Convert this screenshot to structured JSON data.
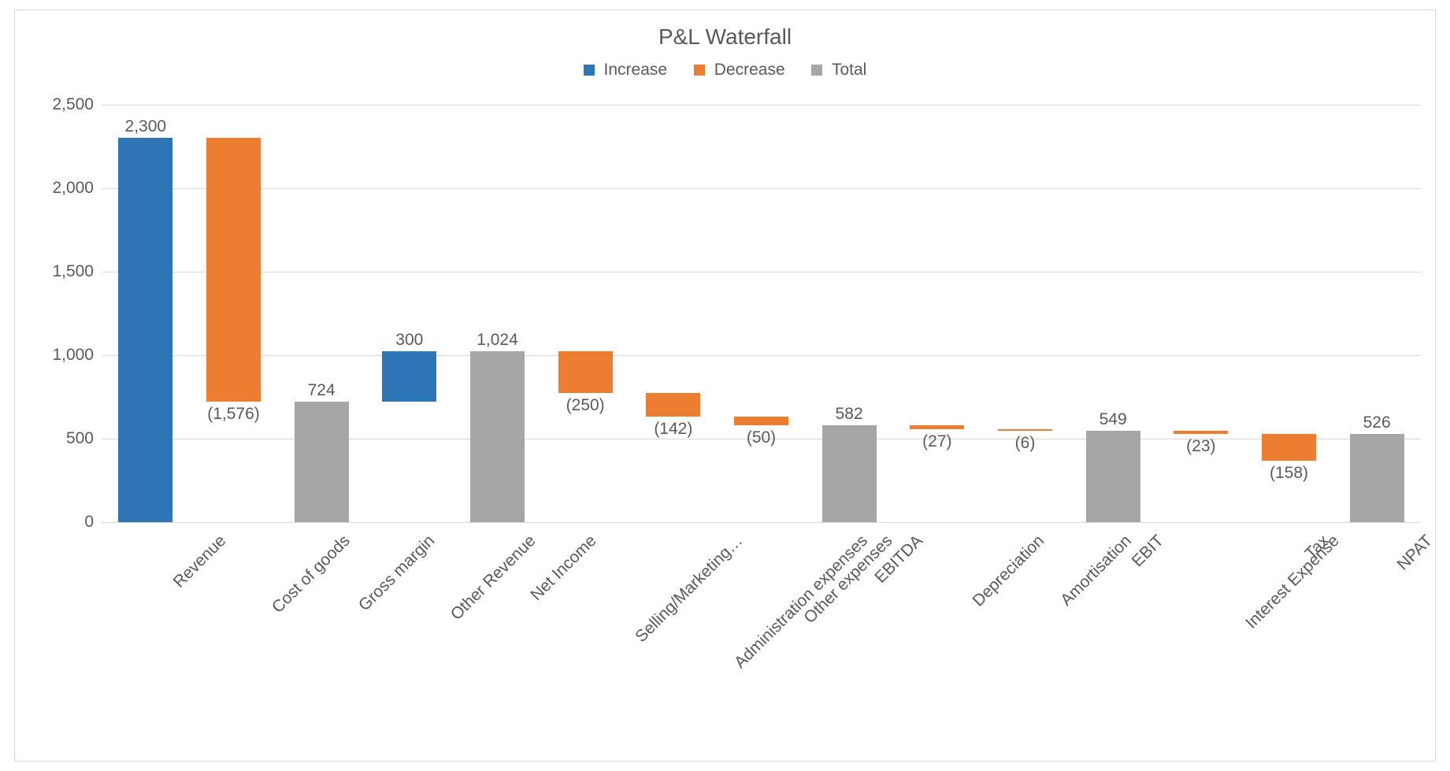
{
  "chart_data": {
    "type": "waterfall",
    "title": "P&L Waterfall",
    "ylim": [
      0,
      2500
    ],
    "ytick_step": 500,
    "legend": [
      {
        "label": "Increase",
        "color": "#2e75b6"
      },
      {
        "label": "Decrease",
        "color": "#ed7d31"
      },
      {
        "label": "Total",
        "color": "#a6a6a6"
      }
    ],
    "items": [
      {
        "category": "Revenue",
        "value": 2300,
        "label": "2,300",
        "kind": "increase",
        "start": 0,
        "end": 2300
      },
      {
        "category": "Cost of goods",
        "value": -1576,
        "label": "(1,576)",
        "kind": "decrease",
        "start": 2300,
        "end": 724
      },
      {
        "category": "Gross margin",
        "value": 724,
        "label": "724",
        "kind": "total",
        "start": 0,
        "end": 724
      },
      {
        "category": "Other Revenue",
        "value": 300,
        "label": "300",
        "kind": "increase",
        "start": 724,
        "end": 1024
      },
      {
        "category": "Net Income",
        "value": 1024,
        "label": "1,024",
        "kind": "total",
        "start": 0,
        "end": 1024
      },
      {
        "category": "Selling/Marketing…",
        "value": -250,
        "label": "(250)",
        "kind": "decrease",
        "start": 1024,
        "end": 774
      },
      {
        "category": "Administration expenses",
        "value": -142,
        "label": "(142)",
        "kind": "decrease",
        "start": 774,
        "end": 632
      },
      {
        "category": "Other expenses",
        "value": -50,
        "label": "(50)",
        "kind": "decrease",
        "start": 632,
        "end": 582
      },
      {
        "category": "EBITDA",
        "value": 582,
        "label": "582",
        "kind": "total",
        "start": 0,
        "end": 582
      },
      {
        "category": "Depreciation",
        "value": -27,
        "label": "(27)",
        "kind": "decrease",
        "start": 582,
        "end": 555
      },
      {
        "category": "Amortisation",
        "value": -6,
        "label": "(6)",
        "kind": "decrease",
        "start": 555,
        "end": 549
      },
      {
        "category": "EBIT",
        "value": 549,
        "label": "549",
        "kind": "total",
        "start": 0,
        "end": 549
      },
      {
        "category": "Interest Expense",
        "value": -23,
        "label": "(23)",
        "kind": "decrease",
        "start": 549,
        "end": 526
      },
      {
        "category": "Tax",
        "value": -158,
        "label": "(158)",
        "kind": "decrease",
        "start": 526,
        "end": 368
      },
      {
        "category": "NPAT",
        "value": 526,
        "label": "526",
        "kind": "total",
        "start": 0,
        "end": 526
      }
    ]
  }
}
